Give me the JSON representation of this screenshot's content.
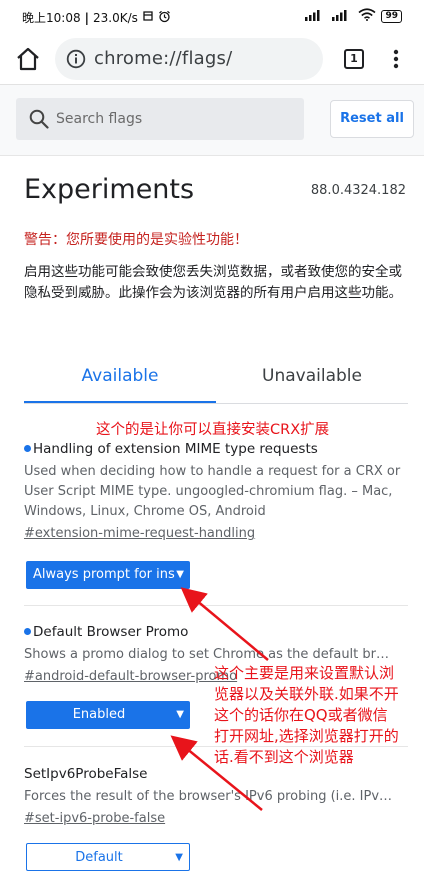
{
  "status_bar": {
    "time": "晚上10:08",
    "speed": "23.0K/s",
    "battery": "99"
  },
  "toolbar": {
    "url": "chrome://flags/",
    "tab_count": "1"
  },
  "search": {
    "placeholder": "Search flags",
    "reset_label": "Reset all"
  },
  "page": {
    "title": "Experiments",
    "version": "88.0.4324.182",
    "warning": "警告：您所要使用的是实验性功能！",
    "intro": "启用这些功能可能会致使您丢失浏览数据，或者致使您的安全或隐私受到威胁。此操作会为该浏览器的所有用户启用这些功能。"
  },
  "tabs": {
    "available": "Available",
    "unavailable": "Unavailable"
  },
  "experiments": [
    {
      "title": "Handling of extension MIME type requests",
      "description": "Used when deciding how to handle a request for a CRX or User Script MIME type. ungoogled-chromium flag. – Mac, Windows, Linux, Chrome OS, Android",
      "link": "#extension-mime-request-handling",
      "selected": "Always prompt for ins"
    },
    {
      "title": "Default Browser Promo",
      "description": "Shows a promo dialog to set Chrome as the default br…",
      "link": "#android-default-browser-promo",
      "selected": "Enabled"
    },
    {
      "title": "SetIpv6ProbeFalse",
      "description": "Forces the result of the browser's IPv6 probing (i.e. IPv…",
      "link": "#set-ipv6-probe-false",
      "selected": "Default"
    }
  ],
  "annotations": {
    "crx": "这个的是让你可以直接安装CRX扩展",
    "browser_lines": [
      "这个主要是用来设置默认浏",
      "览器以及关联外联.如果不开",
      "这个的话你在QQ或者微信",
      "打开网址,选择浏览器打开的",
      "话.看不到这个浏览器"
    ]
  },
  "colors": {
    "accent": "#1a73e8",
    "warning": "#c5221f",
    "annotation": "#e8141b"
  }
}
